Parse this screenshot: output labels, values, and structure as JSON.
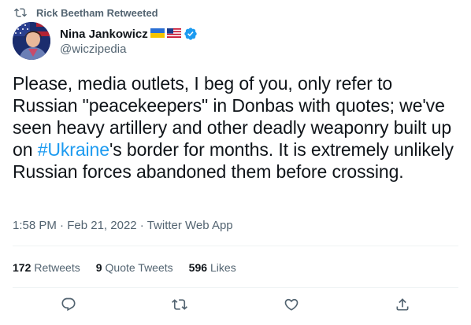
{
  "retweet_banner": {
    "text": "Rick Beetham Retweeted",
    "icon": "retweet-icon"
  },
  "author": {
    "name": "Nina Jankowicz",
    "handle": "@wiczipedia",
    "flags": [
      "ukraine-flag",
      "us-flag"
    ],
    "verified": true
  },
  "tweet": {
    "text_before": "Please, media outlets, I beg of you, only refer to Russian \"peacekeepers\" in Donbas with quotes; we've seen heavy artillery and other deadly weaponry built up on ",
    "hashtag": "#Ukraine",
    "text_after": "'s border for months. It is extremely unlikely Russian forces abandoned them before crossing."
  },
  "meta": {
    "time": "1:58 PM",
    "separator": "·",
    "date": "Feb 21, 2022",
    "source": "Twitter Web App"
  },
  "stats": {
    "retweets_count": "172",
    "retweets_label": "Retweets",
    "quote_count": "9",
    "quote_label": "Quote Tweets",
    "likes_count": "596",
    "likes_label": "Likes"
  },
  "actions": [
    "reply-icon",
    "retweet-icon",
    "like-icon",
    "share-icon"
  ],
  "colors": {
    "link": "#1d9bf0",
    "secondary": "#536471",
    "text": "#0f1419",
    "divider": "#eff3f4"
  }
}
